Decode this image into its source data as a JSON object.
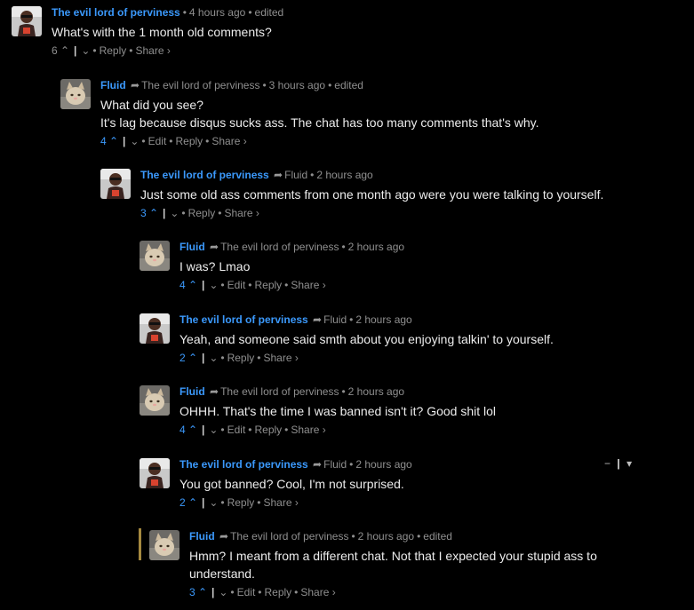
{
  "comments": [
    {
      "author": "The evil lord of perviness",
      "reply_to": "",
      "time": "4 hours ago",
      "edited": "edited",
      "text": [
        "What's with the 1 month old comments?"
      ],
      "votes": "6",
      "vote_active": false,
      "actions": [
        "Reply",
        "Share ›"
      ],
      "avatar": "dark-person"
    },
    {
      "author": "Fluid",
      "reply_to": "The evil lord of perviness",
      "time": "3 hours ago",
      "edited": "edited",
      "text": [
        "What did you see?",
        "It's lag because disqus sucks ass. The chat has too many comments that's why."
      ],
      "votes": "4",
      "vote_active": true,
      "actions": [
        "Edit",
        "Reply",
        "Share ›"
      ],
      "avatar": "cat"
    },
    {
      "author": "The evil lord of perviness",
      "reply_to": "Fluid",
      "time": "2 hours ago",
      "edited": "",
      "text": [
        "Just some old ass comments from one month ago were you were talking to yourself."
      ],
      "votes": "3",
      "vote_active": true,
      "actions": [
        "Reply",
        "Share ›"
      ],
      "avatar": "dark-person"
    },
    {
      "author": "Fluid",
      "reply_to": "The evil lord of perviness",
      "time": "2 hours ago",
      "edited": "",
      "text": [
        "I was? Lmao"
      ],
      "votes": "4",
      "vote_active": true,
      "actions": [
        "Edit",
        "Reply",
        "Share ›"
      ],
      "avatar": "cat"
    },
    {
      "author": "The evil lord of perviness",
      "reply_to": "Fluid",
      "time": "2 hours ago",
      "edited": "",
      "text": [
        "Yeah, and someone said smth about you enjoying talkin' to yourself."
      ],
      "votes": "2",
      "vote_active": true,
      "actions": [
        "Reply",
        "Share ›"
      ],
      "avatar": "dark-person"
    },
    {
      "author": "Fluid",
      "reply_to": "The evil lord of perviness",
      "time": "2 hours ago",
      "edited": "",
      "text": [
        "OHHH. That's the time I was banned isn't it? Good shit lol"
      ],
      "votes": "4",
      "vote_active": true,
      "actions": [
        "Edit",
        "Reply",
        "Share ›"
      ],
      "avatar": "cat"
    },
    {
      "author": "The evil lord of perviness",
      "reply_to": "Fluid",
      "time": "2 hours ago",
      "edited": "",
      "text": [
        "You got banned? Cool, I'm not surprised."
      ],
      "votes": "2",
      "vote_active": true,
      "actions": [
        "Reply",
        "Share ›"
      ],
      "avatar": "dark-person"
    },
    {
      "author": "Fluid",
      "reply_to": "The evil lord of perviness",
      "time": "2 hours ago",
      "edited": "edited",
      "text": [
        "Hmm? I meant from a different chat. Not that I expected your stupid ass to",
        "understand."
      ],
      "votes": "3",
      "vote_active": true,
      "actions": [
        "Edit",
        "Reply",
        "Share ›"
      ],
      "avatar": "cat",
      "highlighted": true
    }
  ],
  "collapse_controls": {
    "minus": "−",
    "bar": "|",
    "caret": "▾"
  },
  "icons": {
    "upvote": "chevron-up-icon",
    "downvote": "chevron-down-icon",
    "reply_arrow": "reply-arrow-icon"
  },
  "colors": {
    "author": "#3b99fc",
    "highlight": "#a5893f",
    "background": "#000000"
  }
}
